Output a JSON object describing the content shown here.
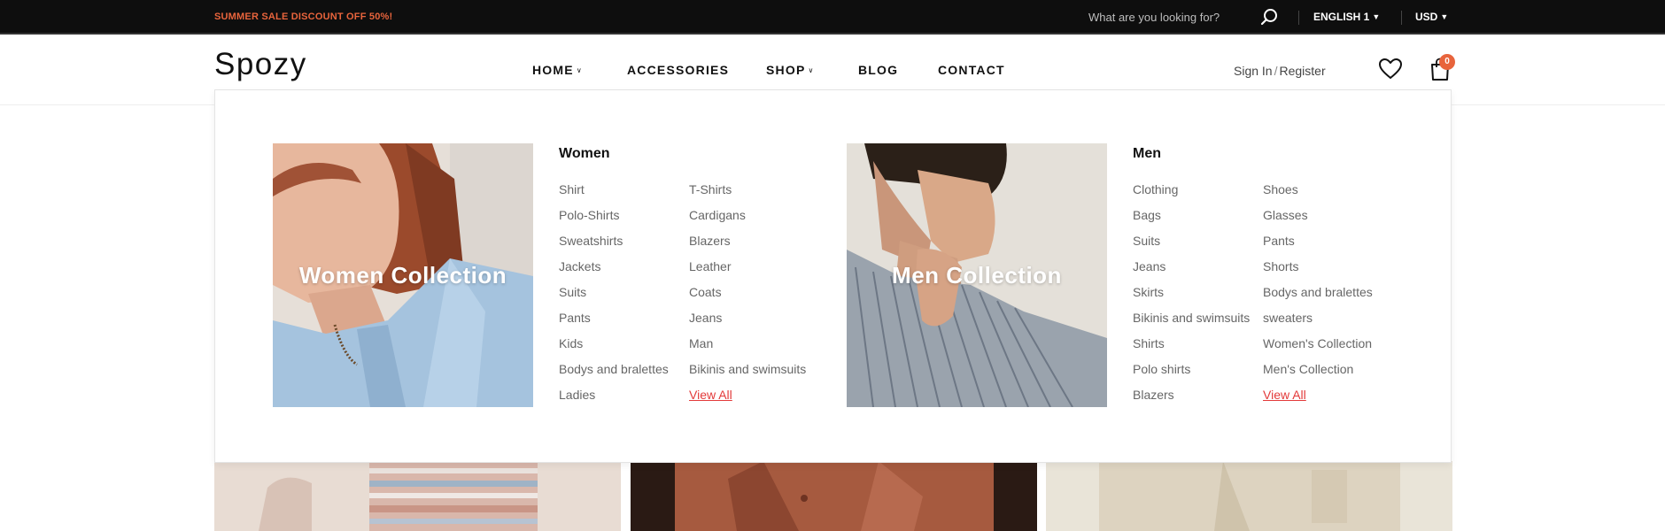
{
  "topbar": {
    "promo": "SUMMER SALE DISCOUNT OFF 50%!",
    "search_placeholder": "What are you looking for?",
    "language": "ENGLISH 1",
    "currency": "USD",
    "promo_color": "#e8643c"
  },
  "header": {
    "logo": "Spozy",
    "nav": [
      {
        "label": "HOME",
        "has_dropdown": true
      },
      {
        "label": "ACCESSORIES",
        "has_dropdown": false
      },
      {
        "label": "SHOP",
        "has_dropdown": true
      },
      {
        "label": "BLOG",
        "has_dropdown": false
      },
      {
        "label": "CONTACT",
        "has_dropdown": false
      }
    ],
    "sign_in": "Sign In",
    "register": "Register",
    "cart_count": "0",
    "icons": [
      "search-icon",
      "heart-icon",
      "shopping-bag-icon"
    ]
  },
  "mega_menu": {
    "women": {
      "banner": "Women Collection",
      "title": "Women",
      "col1": [
        "Shirt",
        "Polo-Shirts",
        "Sweatshirts",
        "Jackets",
        "Suits",
        "Pants",
        "Kids",
        "Bodys and bralettes",
        "Ladies"
      ],
      "col2": [
        "T-Shirts",
        "Cardigans",
        "Blazers",
        "Leather",
        "Coats",
        "Jeans",
        "Man",
        "Bikinis and swimsuits"
      ],
      "view_all": "View All"
    },
    "men": {
      "banner": "Men Collection",
      "title": "Men",
      "col1": [
        "Clothing",
        "Bags",
        "Suits",
        "Jeans",
        "Skirts",
        "Bikinis and swimsuits",
        "Shirts",
        "Polo shirts",
        "Blazers"
      ],
      "col2": [
        "Shoes",
        "Glasses",
        "Pants",
        "Shorts",
        "Bodys and bralettes",
        "sweaters",
        "Women's Collection",
        "Men's Collection"
      ],
      "view_all": "View All"
    },
    "link_accent": "#e33a3a"
  }
}
